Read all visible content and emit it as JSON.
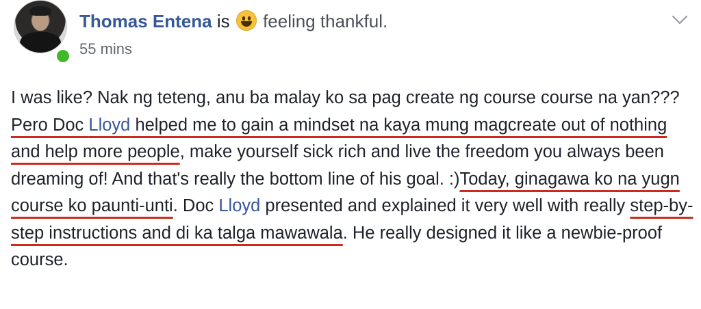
{
  "post": {
    "author": "Thomas Entena",
    "verb": "is",
    "emoji_icon": "grinning-face-emoji",
    "feeling": "feeling thankful.",
    "timestamp": "55 mins",
    "online_status_color": "#42b72a",
    "link_color": "#365899",
    "highlight_underline_color": "#cc2a1c",
    "menu_icon": "chevron-down-icon"
  },
  "body_segments": {
    "s1": "I was like? Nak ng teteng, anu ba malay ko sa pag create ng course course na yan??? ",
    "s2": "Pero Doc ",
    "s3": "Lloyd",
    "s4": " helped me to gain a mindset na kaya mung magcreate out of nothing and help more people",
    "s5": ", make yourself sick rich and live the freedom you always been dreaming of! And that's really the bottom line of his goal. :)",
    "s6": "Today, ginagawa ko na yugn course ko paunti-unti",
    "s7": ". Doc ",
    "s8": "Lloyd",
    "s9": " presented and explained it very well with really ",
    "s10": "step-by-step instructions and di ka talga mawawala",
    "s11": ". He really designed it like a newbie-proof course."
  }
}
